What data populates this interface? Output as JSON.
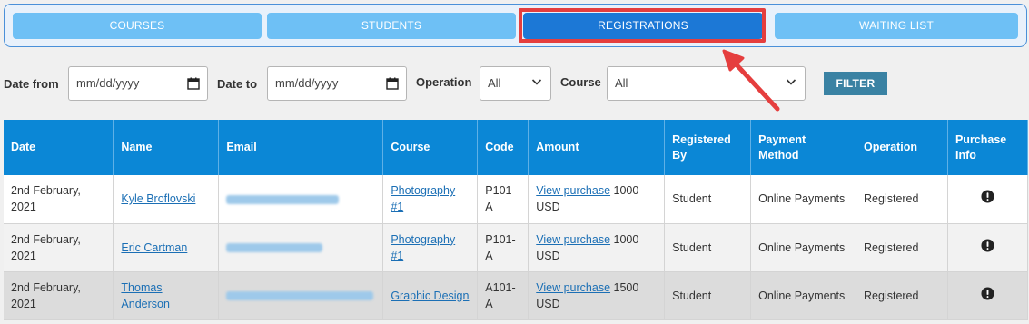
{
  "tabs": [
    {
      "label": "COURSES",
      "active": false
    },
    {
      "label": "STUDENTS",
      "active": false
    },
    {
      "label": "REGISTRATIONS",
      "active": true
    },
    {
      "label": "WAITING LIST",
      "active": false
    }
  ],
  "filters": {
    "date_from_label": "Date from",
    "date_from_placeholder": "mm/dd/yyyy",
    "date_to_label": "Date to",
    "date_to_placeholder": "mm/dd/yyyy",
    "operation_label": "Operation",
    "operation_value": "All",
    "course_label": "Course",
    "course_value": "All",
    "filter_button": "FILTER"
  },
  "table": {
    "headers": [
      "Date",
      "Name",
      "Email",
      "Course",
      "Code",
      "Amount",
      "Registered By",
      "Payment Method",
      "Operation",
      "Purchase Info"
    ],
    "rows": [
      {
        "date": "2nd February, 2021",
        "name": "Kyle Broflovski",
        "course": "Photography #1",
        "code": "P101-A",
        "amount_link": "View purchase",
        "amount": "1000 USD",
        "registered_by": "Student",
        "payment_method": "Online Payments",
        "operation": "Registered"
      },
      {
        "date": "2nd February, 2021",
        "name": "Eric Cartman",
        "course": "Photography #1",
        "code": "P101-A",
        "amount_link": "View purchase",
        "amount": "1000 USD",
        "registered_by": "Student",
        "payment_method": "Online Payments",
        "operation": "Registered"
      },
      {
        "date": "2nd February, 2021",
        "name": "Thomas Anderson",
        "course": "Graphic Design",
        "code": "A101-A",
        "amount_link": "View purchase",
        "amount": "1500 USD",
        "registered_by": "Student",
        "payment_method": "Online Payments",
        "operation": "Registered"
      }
    ]
  },
  "icons": {
    "calendar": "calendar-icon",
    "dropdown": "chevron-down-icon",
    "purchase_info": "exclamation-circle-icon"
  },
  "colors": {
    "tab_inactive": "#6ec0f5",
    "tab_active": "#1c78d6",
    "header_bg": "#0b87d6",
    "filter_button": "#3a82a3",
    "highlight": "#e53e3e",
    "link": "#1b6fb5"
  }
}
